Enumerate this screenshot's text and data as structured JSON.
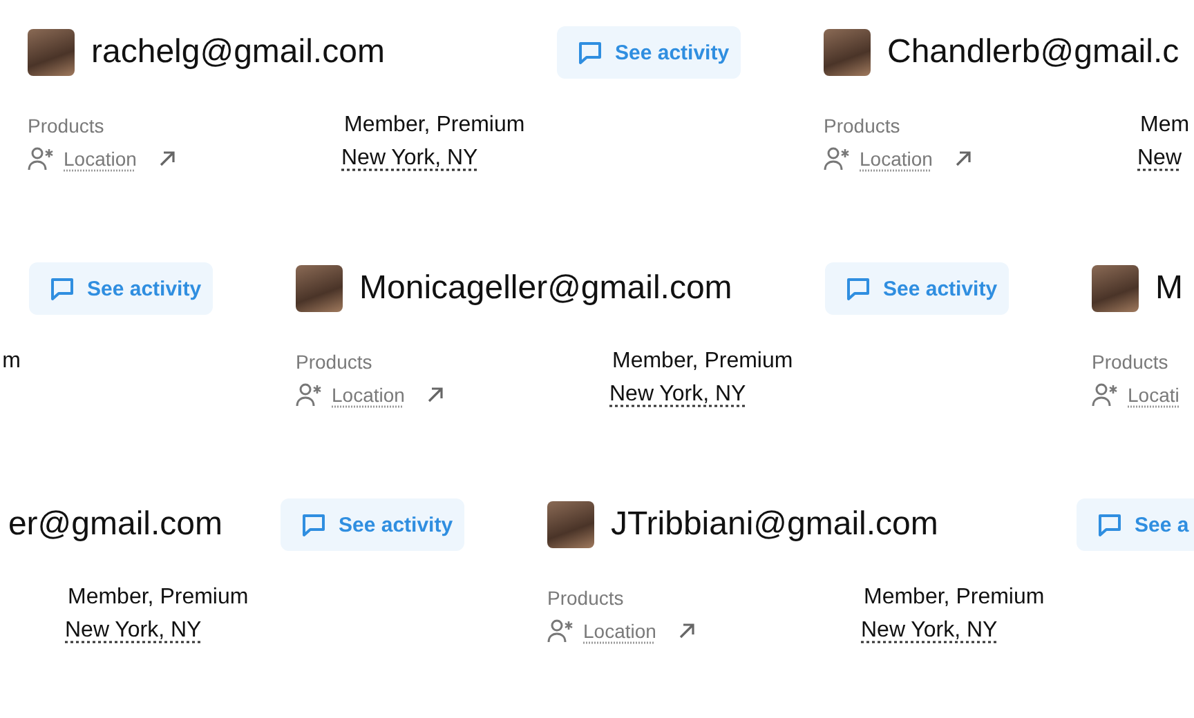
{
  "rows": [
    {
      "cards": [
        {
          "kind": "full",
          "email": "rachelg@gmail.com",
          "button": "See activity",
          "products_label": "Products",
          "location": "Location",
          "location_external": true,
          "membership": "Member, Premium",
          "city": "New York, NY"
        },
        {
          "kind": "full",
          "email": "Chandlerb@gmail.c",
          "products_label": "Products",
          "location": "Location",
          "location_external": true,
          "membership": "Mem",
          "city": "New"
        }
      ]
    },
    {
      "cards": [
        {
          "kind": "left_sliver",
          "button": "See activity",
          "membership": "m"
        },
        {
          "kind": "full",
          "email": "Monicageller@gmail.com",
          "button": "See activity",
          "products_label": "Products",
          "location": "Location",
          "location_external": true,
          "membership": "Member, Premium",
          "city": "New York, NY"
        },
        {
          "kind": "full",
          "email": "M",
          "products_label": "Products",
          "location": "Locati",
          "location_external": false
        }
      ]
    },
    {
      "cards": [
        {
          "kind": "left_edge",
          "email": "er@gmail.com",
          "button": "See activity",
          "membership": "Member, Premium",
          "city": "New York, NY"
        },
        {
          "kind": "full",
          "email": "JTribbiani@gmail.com",
          "button": "See a",
          "products_label": "Products",
          "location": "Location",
          "location_external": true,
          "membership": "Member, Premium",
          "city": "New York, NY"
        }
      ]
    }
  ]
}
